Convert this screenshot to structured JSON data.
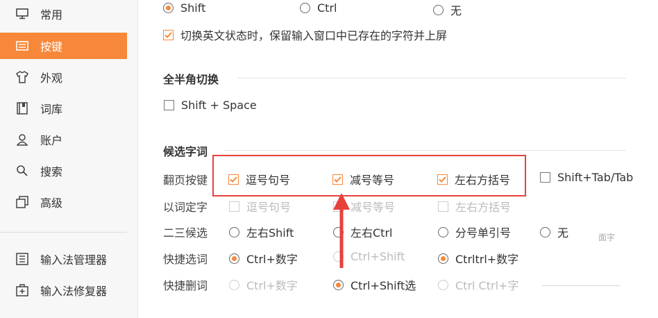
{
  "sidebar": {
    "items": [
      {
        "label": "常用",
        "icon": "monitor-icon"
      },
      {
        "label": "按键",
        "icon": "keyboard-icon"
      },
      {
        "label": "外观",
        "icon": "shirt-icon"
      },
      {
        "label": "词库",
        "icon": "book-icon"
      },
      {
        "label": "账户",
        "icon": "user-icon"
      },
      {
        "label": "搜索",
        "icon": "search-icon"
      },
      {
        "label": "高级",
        "icon": "layers-icon"
      }
    ],
    "tools": [
      {
        "label": "输入法管理器",
        "icon": "list-icon"
      },
      {
        "label": "输入法修复器",
        "icon": "repair-icon"
      }
    ],
    "active_color": "#f7883a"
  },
  "switch_key": {
    "options": [
      "Shift",
      "Ctrl",
      "无"
    ],
    "selected": "Shift",
    "keep_chars_label": "切换英文状态时，保留输入窗口中已存在的字符并上屏",
    "keep_chars_checked": true
  },
  "full_half": {
    "title": "全半角切换",
    "shortcut_label": "Shift + Space",
    "checked": false
  },
  "candidates": {
    "title": "候选字词",
    "page_keys": {
      "label": "翻页按键",
      "options": [
        {
          "label": "逗号句号",
          "checked": true
        },
        {
          "label": "减号等号",
          "checked": true
        },
        {
          "label": "左右方括号",
          "checked": true
        },
        {
          "label": "Shift+Tab/Tab",
          "checked": false
        }
      ]
    },
    "word_select": {
      "label": "以词定字",
      "options": [
        "逗号句号",
        "减号等号",
        "左右方括号"
      ]
    },
    "second_third": {
      "label": "二三候选",
      "options": [
        "左右Shift",
        "左右Ctrl",
        "分号单引号",
        "无"
      ],
      "extra": "面字"
    },
    "quick_select": {
      "label": "快捷选词",
      "options": [
        "Ctrl+数字",
        "Ctrl+Shift",
        "Ctrltrl+数字"
      ]
    },
    "quick_delete": {
      "label": "快捷删词",
      "options": [
        "Ctrl+数字",
        "Ctrl+Shift选",
        "Ctrl Ctrl+字"
      ]
    }
  },
  "accent_color": "#f7883a",
  "highlight_color": "#e8413c"
}
